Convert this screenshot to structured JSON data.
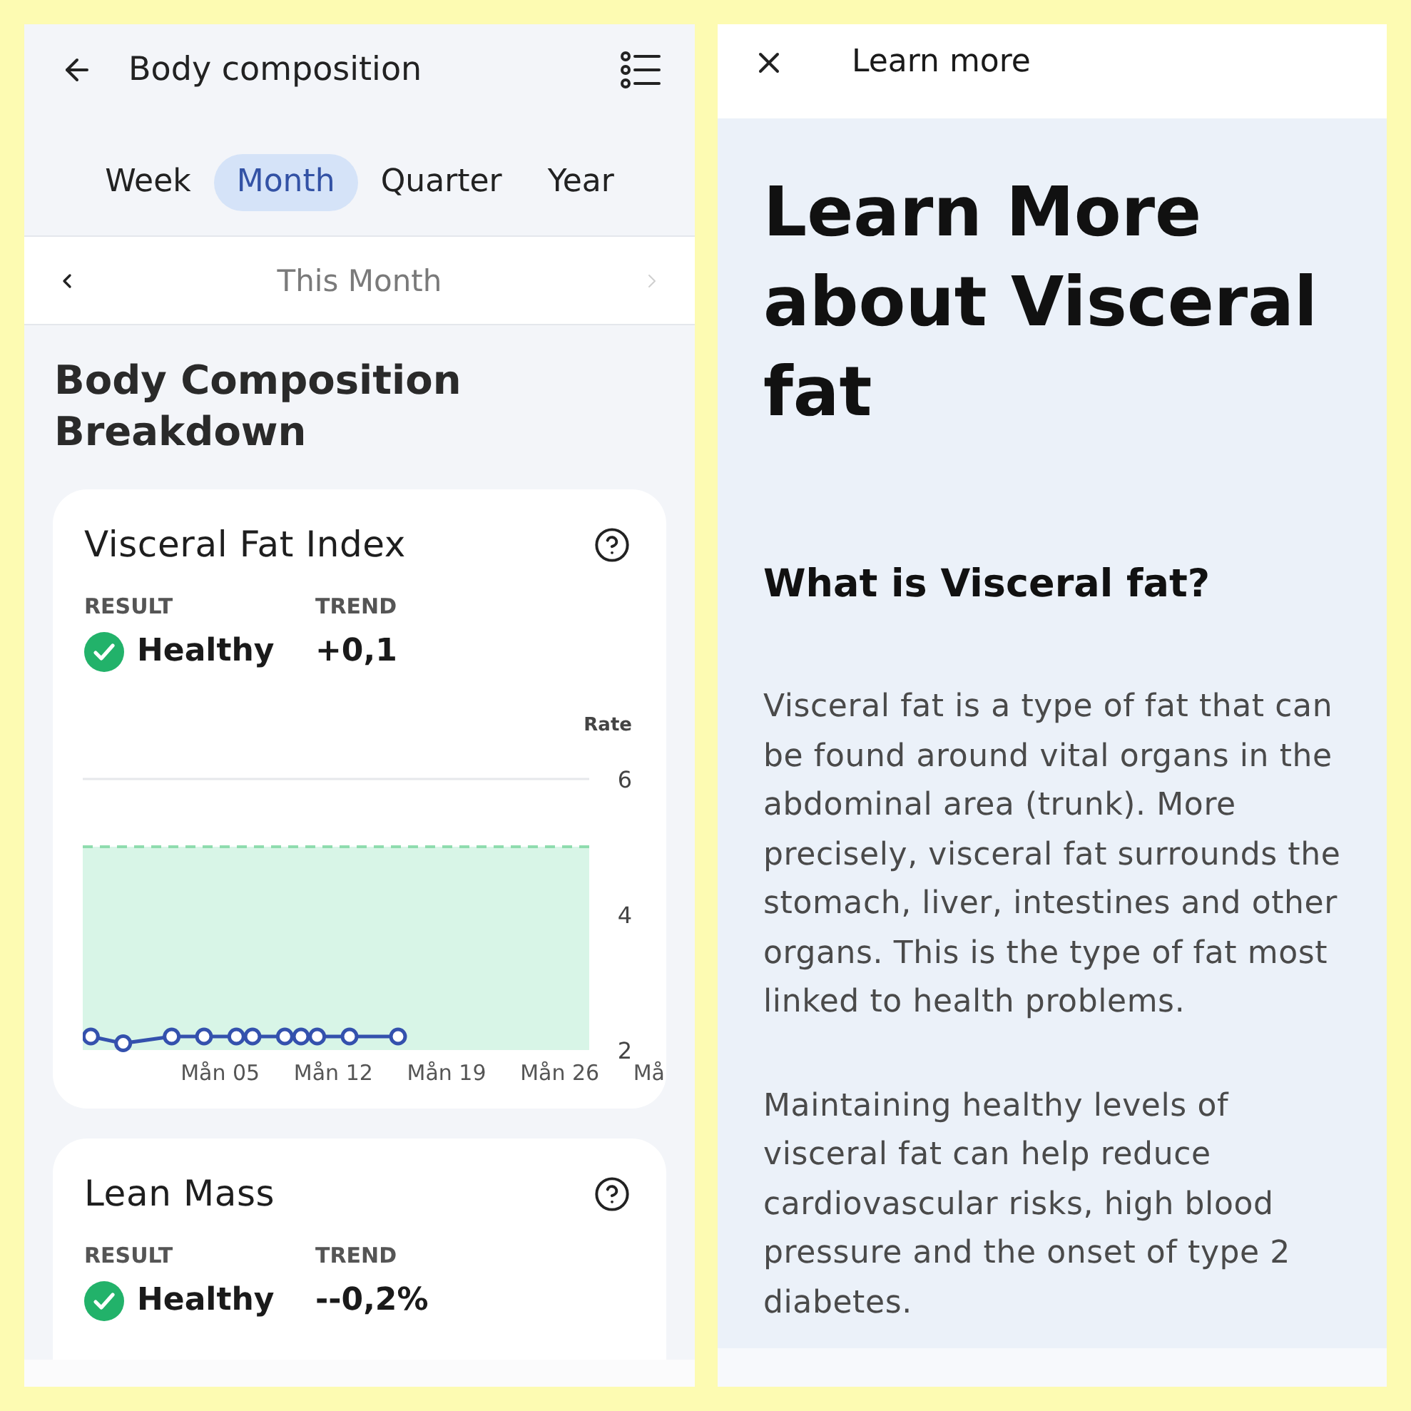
{
  "left_screen": {
    "header": {
      "title": "Body composition"
    },
    "tabs": [
      {
        "label": "Week",
        "selected": false
      },
      {
        "label": "Month",
        "selected": true
      },
      {
        "label": "Quarter",
        "selected": false
      },
      {
        "label": "Year",
        "selected": false
      }
    ],
    "period_nav": {
      "label": "This Month",
      "previous_disabled": false,
      "next_disabled": true
    },
    "section_title": "Body Composition Breakdown",
    "cards": [
      {
        "title": "Visceral Fat Index",
        "result_label": "RESULT",
        "result": "Healthy",
        "trend_label": "TREND",
        "trend": "+0,1",
        "chart_data": {
          "type": "line",
          "marker": "o",
          "ylabel": "Rate",
          "categories": [
            null,
            null,
            null,
            null,
            null,
            null,
            null,
            null,
            "Mån 05",
            null,
            null,
            null,
            null,
            null,
            null,
            "Mån 12",
            null,
            null,
            null,
            null,
            null,
            null,
            "Mån 19",
            null,
            null,
            null,
            null,
            null,
            null,
            "Mån 26",
            null,
            null,
            null,
            null,
            null,
            "Må"
          ],
          "values": [
            2.2,
            null,
            2.1,
            null,
            null,
            2.2,
            null,
            2.2,
            null,
            2.2,
            2.2,
            null,
            2.2,
            2.2,
            2.2,
            null,
            2.2,
            null,
            null,
            2.2,
            null,
            null,
            null,
            null,
            null,
            null,
            null,
            null,
            null,
            null,
            null,
            null,
            null,
            null,
            null,
            null
          ],
          "ylim": [
            2,
            6
          ],
          "yticks": [
            2,
            4,
            6
          ],
          "bands": [
            {
              "axis": "y",
              "from": 2,
              "to": 5
            }
          ],
          "ref_lines": [
            {
              "axis": "y",
              "value": 5
            }
          ]
        }
      },
      {
        "title": "Lean Mass",
        "result_label": "RESULT",
        "result": "Healthy",
        "trend_label": "TREND",
        "trend": "--0,2%"
      }
    ]
  },
  "right_screen": {
    "header": {
      "title": "Learn more"
    },
    "title": "Learn More about Visceral fat",
    "heading": "What is Visceral fat?",
    "paragraphs": [
      "Visceral fat is a type of fat that can be found around vital organs in the abdominal area (trunk). More precisely, visceral fat surrounds the stomach, liver, intestines and other organs. This is the type of fat most linked to health problems.",
      "Maintaining healthy levels of visceral fat can help reduce cardiovascular risks, high blood pressure and the onset of type 2 diabetes."
    ]
  }
}
